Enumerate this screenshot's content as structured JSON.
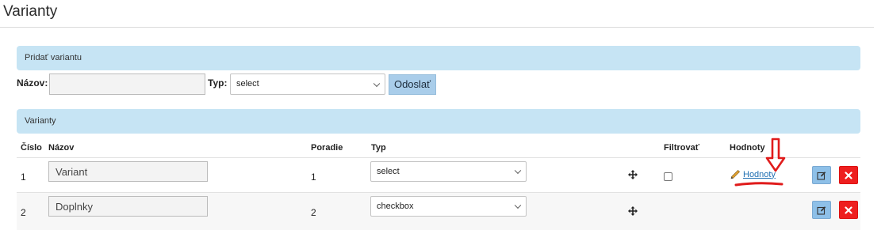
{
  "page": {
    "title": "Varianty"
  },
  "add_panel": {
    "heading": "Pridať variantu",
    "name_label": "Názov:",
    "name_value": "",
    "type_label": "Typ:",
    "type_value": "select",
    "submit_label": "Odoslať"
  },
  "list_panel": {
    "heading": "Varianty",
    "columns": {
      "number": "Číslo",
      "name": "Názov",
      "order": "Poradie",
      "type": "Typ",
      "filter": "Filtrovať",
      "values": "Hodnoty"
    },
    "rows": [
      {
        "number": "1",
        "name": "Variant",
        "order": "1",
        "type": "select",
        "filter_checked": false,
        "values_link": "Hodnoty"
      },
      {
        "number": "2",
        "name": "Doplnky",
        "order": "2",
        "type": "checkbox"
      }
    ]
  },
  "colors": {
    "panel_heading_bg": "#c6e4f4",
    "edit_button": "#8ec0e8",
    "delete_button": "#ee1f1f",
    "link": "#1f6fb2",
    "annotation": "#e01b1b"
  },
  "icons": {
    "move": "move-arrows-icon",
    "pencil": "pencil-icon",
    "edit": "edit-icon",
    "delete": "close-icon",
    "dropdown": "chevron-down-icon",
    "annotation": "arrow-down-icon"
  }
}
